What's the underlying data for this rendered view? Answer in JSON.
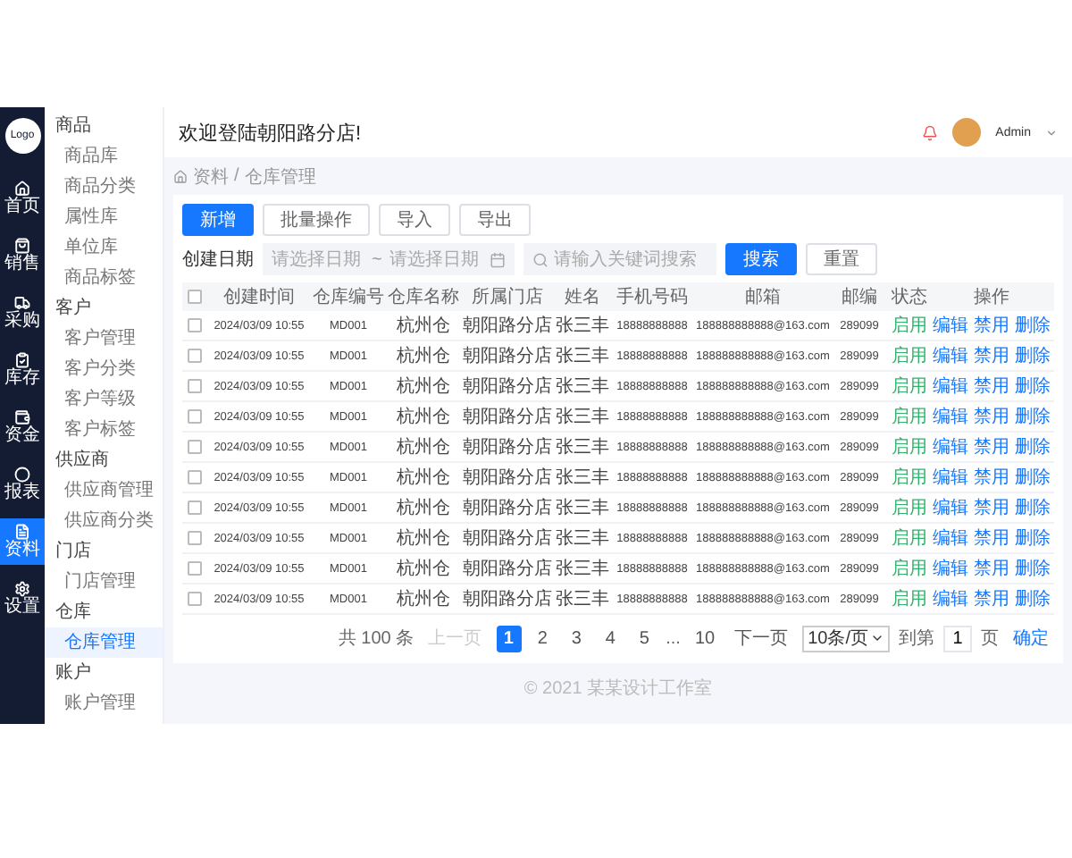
{
  "sidebar": {
    "logo": "Logo",
    "items": [
      {
        "label": "首页",
        "selected": false
      },
      {
        "label": "销售",
        "selected": false
      },
      {
        "label": "采购",
        "selected": false
      },
      {
        "label": "库存",
        "selected": false
      },
      {
        "label": "资金",
        "selected": false
      },
      {
        "label": "报表",
        "selected": false
      },
      {
        "label": "资料",
        "selected": true
      },
      {
        "label": "设置",
        "selected": false
      }
    ]
  },
  "submenu": {
    "groups": [
      {
        "title": "商品",
        "items": [
          {
            "label": "商品库",
            "selected": false
          },
          {
            "label": "商品分类",
            "selected": false
          },
          {
            "label": "属性库",
            "selected": false
          },
          {
            "label": "单位库",
            "selected": false
          },
          {
            "label": "商品标签",
            "selected": false
          }
        ]
      },
      {
        "title": "客户",
        "items": [
          {
            "label": "客户管理",
            "selected": false
          },
          {
            "label": "客户分类",
            "selected": false
          },
          {
            "label": "客户等级",
            "selected": false
          },
          {
            "label": "客户标签",
            "selected": false
          }
        ]
      },
      {
        "title": "供应商",
        "items": [
          {
            "label": "供应商管理",
            "selected": false
          },
          {
            "label": "供应商分类",
            "selected": false
          }
        ]
      },
      {
        "title": "门店",
        "items": [
          {
            "label": "门店管理",
            "selected": false
          }
        ]
      },
      {
        "title": "仓库",
        "items": [
          {
            "label": "仓库管理",
            "selected": true
          }
        ]
      },
      {
        "title": "账户",
        "items": [
          {
            "label": "账户管理",
            "selected": false
          }
        ]
      }
    ]
  },
  "header": {
    "welcome": "欢迎登陆朝阳路分店!",
    "user": "Admin"
  },
  "breadcrumb": {
    "items": [
      "资料",
      "仓库管理"
    ],
    "separator": "/"
  },
  "toolbar": {
    "buttons": [
      {
        "label": "新增",
        "kind": "primary"
      },
      {
        "label": "批量操作",
        "kind": "default"
      },
      {
        "label": "导入",
        "kind": "default"
      },
      {
        "label": "导出",
        "kind": "default"
      }
    ]
  },
  "filter": {
    "label": "创建日期",
    "start_placeholder": "请选择日期",
    "range_separator": "~",
    "end_placeholder": "请选择日期",
    "search_placeholder": "请输入关键词搜索",
    "buttons": [
      {
        "label": "搜索",
        "kind": "primary"
      },
      {
        "label": "重置",
        "kind": "default"
      }
    ]
  },
  "table": {
    "header_checked": false,
    "columns": [
      "创建时间",
      "仓库编号",
      "仓库名称",
      "所属门店",
      "姓名",
      "手机号码",
      "邮箱",
      "邮编",
      "状态",
      "操作"
    ],
    "rows": [
      {
        "checked": false,
        "cells": [
          "2024/03/09 10:55",
          "MD001",
          "杭州仓",
          "朝阳路分店",
          "张三丰",
          "18888888888",
          "188888888888@163.com",
          "289099"
        ],
        "status": "启用",
        "actions": [
          "编辑",
          "禁用",
          "删除"
        ]
      },
      {
        "checked": false,
        "cells": [
          "2024/03/09 10:55",
          "MD001",
          "杭州仓",
          "朝阳路分店",
          "张三丰",
          "18888888888",
          "188888888888@163.com",
          "289099"
        ],
        "status": "启用",
        "actions": [
          "编辑",
          "禁用",
          "删除"
        ]
      },
      {
        "checked": false,
        "cells": [
          "2024/03/09 10:55",
          "MD001",
          "杭州仓",
          "朝阳路分店",
          "张三丰",
          "18888888888",
          "188888888888@163.com",
          "289099"
        ],
        "status": "启用",
        "actions": [
          "编辑",
          "禁用",
          "删除"
        ]
      },
      {
        "checked": false,
        "cells": [
          "2024/03/09 10:55",
          "MD001",
          "杭州仓",
          "朝阳路分店",
          "张三丰",
          "18888888888",
          "188888888888@163.com",
          "289099"
        ],
        "status": "启用",
        "actions": [
          "编辑",
          "禁用",
          "删除"
        ]
      },
      {
        "checked": false,
        "cells": [
          "2024/03/09 10:55",
          "MD001",
          "杭州仓",
          "朝阳路分店",
          "张三丰",
          "18888888888",
          "188888888888@163.com",
          "289099"
        ],
        "status": "启用",
        "actions": [
          "编辑",
          "禁用",
          "删除"
        ]
      },
      {
        "checked": false,
        "cells": [
          "2024/03/09 10:55",
          "MD001",
          "杭州仓",
          "朝阳路分店",
          "张三丰",
          "18888888888",
          "188888888888@163.com",
          "289099"
        ],
        "status": "启用",
        "actions": [
          "编辑",
          "禁用",
          "删除"
        ]
      },
      {
        "checked": false,
        "cells": [
          "2024/03/09 10:55",
          "MD001",
          "杭州仓",
          "朝阳路分店",
          "张三丰",
          "18888888888",
          "188888888888@163.com",
          "289099"
        ],
        "status": "启用",
        "actions": [
          "编辑",
          "禁用",
          "删除"
        ]
      },
      {
        "checked": false,
        "cells": [
          "2024/03/09 10:55",
          "MD001",
          "杭州仓",
          "朝阳路分店",
          "张三丰",
          "18888888888",
          "188888888888@163.com",
          "289099"
        ],
        "status": "启用",
        "actions": [
          "编辑",
          "禁用",
          "删除"
        ]
      },
      {
        "checked": false,
        "cells": [
          "2024/03/09 10:55",
          "MD001",
          "杭州仓",
          "朝阳路分店",
          "张三丰",
          "18888888888",
          "188888888888@163.com",
          "289099"
        ],
        "status": "启用",
        "actions": [
          "编辑",
          "禁用",
          "删除"
        ]
      },
      {
        "checked": false,
        "cells": [
          "2024/03/09 10:55",
          "MD001",
          "杭州仓",
          "朝阳路分店",
          "张三丰",
          "18888888888",
          "188888888888@163.com",
          "289099"
        ],
        "status": "启用",
        "actions": [
          "编辑",
          "禁用",
          "删除"
        ]
      }
    ]
  },
  "pagination": {
    "total": "共 100 条",
    "prev": {
      "label": "上一页",
      "disabled": true
    },
    "pages": [
      {
        "label": "1",
        "kind": "page",
        "selected": true
      },
      {
        "label": "2",
        "kind": "page",
        "selected": false
      },
      {
        "label": "3",
        "kind": "page",
        "selected": false
      },
      {
        "label": "4",
        "kind": "page",
        "selected": false
      },
      {
        "label": "5",
        "kind": "page",
        "selected": false
      },
      {
        "label": "...",
        "kind": "ellipsis"
      },
      {
        "label": "10",
        "kind": "page",
        "selected": false
      }
    ],
    "next": "下一页",
    "page_size": "10条/页",
    "goto_label": "到第",
    "goto_value": "1",
    "goto_unit": "页",
    "confirm": "确定"
  },
  "footer": "© 2021 某某设计工作室"
}
